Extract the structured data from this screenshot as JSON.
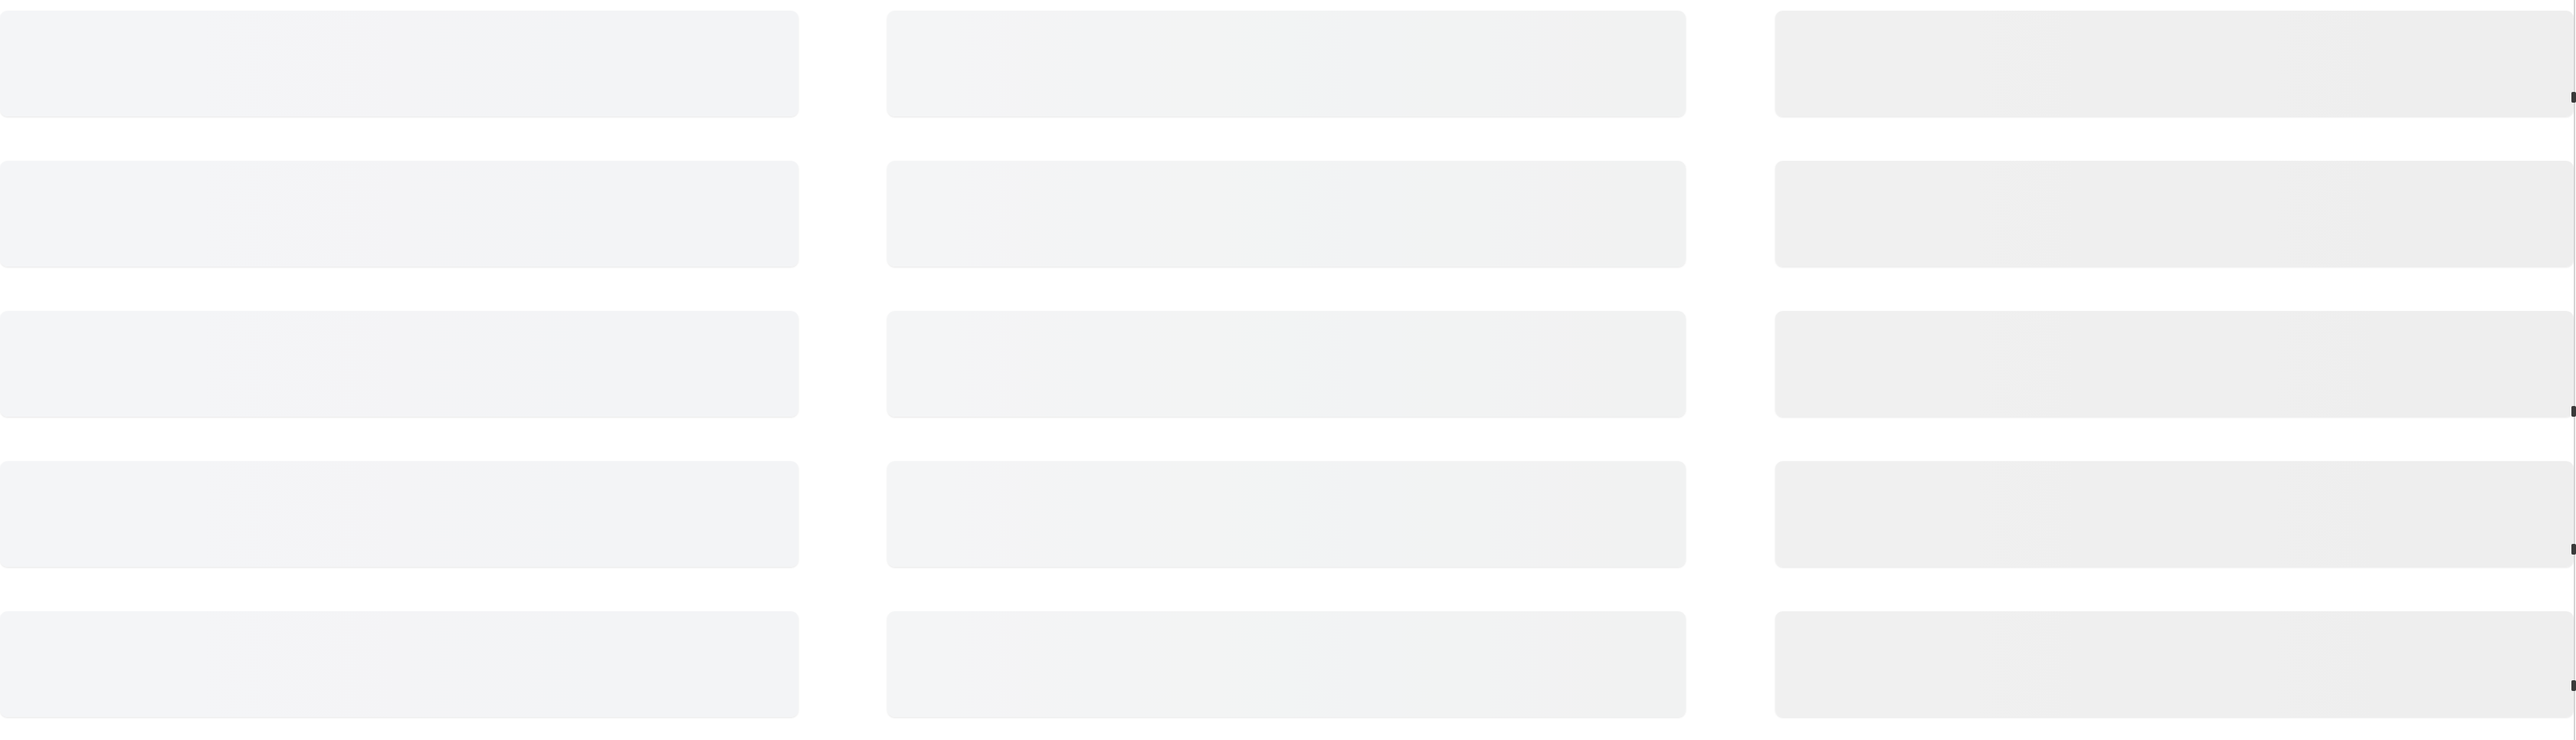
{
  "columns": [
    {
      "cards": [
        {
          "label": ""
        },
        {
          "label": ""
        },
        {
          "label": ""
        },
        {
          "label": ""
        },
        {
          "label": ""
        }
      ]
    },
    {
      "cards": [
        {
          "label": ""
        },
        {
          "label": ""
        },
        {
          "label": ""
        },
        {
          "label": ""
        },
        {
          "label": ""
        }
      ]
    },
    {
      "cards": [
        {
          "label": ""
        },
        {
          "label": ""
        },
        {
          "label": ""
        },
        {
          "label": ""
        },
        {
          "label": ""
        }
      ]
    }
  ],
  "colors": {
    "background": "#ffffff",
    "column_1_card": "#f4f5f7",
    "column_2_card": "#f3f4f4",
    "column_3_card": "#efefef",
    "edge_line": "#d4d4d4",
    "edge_ticks": "#3a3a3a"
  }
}
